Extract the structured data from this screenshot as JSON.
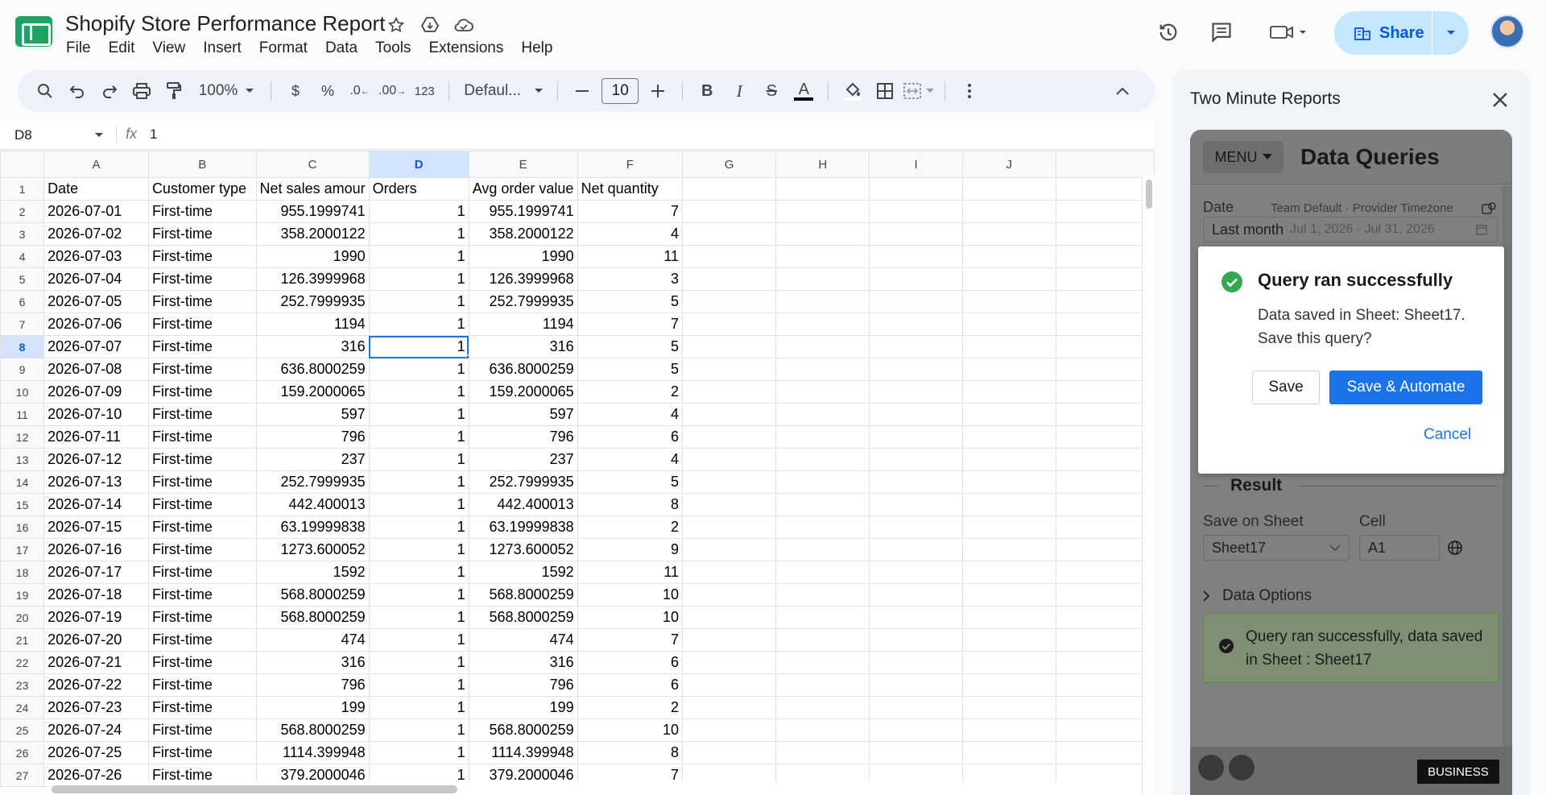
{
  "doc": {
    "title": "Shopify Store Performance Report"
  },
  "menu": [
    "File",
    "Edit",
    "View",
    "Insert",
    "Format",
    "Data",
    "Tools",
    "Extensions",
    "Help"
  ],
  "share": {
    "label": "Share"
  },
  "toolbar": {
    "zoom": "100%",
    "currency": "$",
    "percent": "%",
    "dec_less": ".0",
    "dec_more": ".00",
    "more_formats": "123",
    "font": "Defaul...",
    "font_size": "10",
    "bold": "B",
    "italic": "I",
    "strike": "S",
    "text_color": "A"
  },
  "formula_bar": {
    "cell_ref": "D8",
    "fx": "fx",
    "value": "1"
  },
  "grid": {
    "columns": [
      "A",
      "B",
      "C",
      "D",
      "E",
      "F",
      "G",
      "H",
      "I",
      "J"
    ],
    "selected_col": "D",
    "selected_row": 8,
    "headers": [
      "Date",
      "Customer type",
      "Net sales amour",
      "Orders",
      "Avg order value",
      "Net quantity"
    ],
    "rows": [
      [
        "2026-07-01",
        "First-time",
        "955.1999741",
        "1",
        "955.1999741",
        "7"
      ],
      [
        "2026-07-02",
        "First-time",
        "358.2000122",
        "1",
        "358.2000122",
        "4"
      ],
      [
        "2026-07-03",
        "First-time",
        "1990",
        "1",
        "1990",
        "11"
      ],
      [
        "2026-07-04",
        "First-time",
        "126.3999968",
        "1",
        "126.3999968",
        "3"
      ],
      [
        "2026-07-05",
        "First-time",
        "252.7999935",
        "1",
        "252.7999935",
        "5"
      ],
      [
        "2026-07-06",
        "First-time",
        "1194",
        "1",
        "1194",
        "7"
      ],
      [
        "2026-07-07",
        "First-time",
        "316",
        "1",
        "316",
        "5"
      ],
      [
        "2026-07-08",
        "First-time",
        "636.8000259",
        "1",
        "636.8000259",
        "5"
      ],
      [
        "2026-07-09",
        "First-time",
        "159.2000065",
        "1",
        "159.2000065",
        "2"
      ],
      [
        "2026-07-10",
        "First-time",
        "597",
        "1",
        "597",
        "4"
      ],
      [
        "2026-07-11",
        "First-time",
        "796",
        "1",
        "796",
        "6"
      ],
      [
        "2026-07-12",
        "First-time",
        "237",
        "1",
        "237",
        "4"
      ],
      [
        "2026-07-13",
        "First-time",
        "252.7999935",
        "1",
        "252.7999935",
        "5"
      ],
      [
        "2026-07-14",
        "First-time",
        "442.400013",
        "1",
        "442.400013",
        "8"
      ],
      [
        "2026-07-15",
        "First-time",
        "63.19999838",
        "1",
        "63.19999838",
        "2"
      ],
      [
        "2026-07-16",
        "First-time",
        "1273.600052",
        "1",
        "1273.600052",
        "9"
      ],
      [
        "2026-07-17",
        "First-time",
        "1592",
        "1",
        "1592",
        "11"
      ],
      [
        "2026-07-18",
        "First-time",
        "568.8000259",
        "1",
        "568.8000259",
        "10"
      ],
      [
        "2026-07-19",
        "First-time",
        "568.8000259",
        "1",
        "568.8000259",
        "10"
      ],
      [
        "2026-07-20",
        "First-time",
        "474",
        "1",
        "474",
        "7"
      ],
      [
        "2026-07-21",
        "First-time",
        "316",
        "1",
        "316",
        "6"
      ],
      [
        "2026-07-22",
        "First-time",
        "796",
        "1",
        "796",
        "6"
      ],
      [
        "2026-07-23",
        "First-time",
        "199",
        "1",
        "199",
        "2"
      ],
      [
        "2026-07-24",
        "First-time",
        "568.8000259",
        "1",
        "568.8000259",
        "10"
      ],
      [
        "2026-07-25",
        "First-time",
        "1114.399948",
        "1",
        "1114.399948",
        "8"
      ],
      [
        "2026-07-26",
        "First-time",
        "379.2000046",
        "1",
        "379.2000046",
        "7"
      ]
    ]
  },
  "sidepanel": {
    "title": "Two Minute Reports",
    "menu_label": "MENU",
    "heading": "Data Queries",
    "date_label": "Date",
    "date_meta": "Team Default · Provider Timezone",
    "date_value": "Last month",
    "date_range": "Jul 1, 2026 - Jul 31, 2026",
    "result_label": "Result",
    "save_on_sheet_label": "Save on Sheet",
    "cell_label": "Cell",
    "sheet_value": "Sheet17",
    "cell_value": "A1",
    "data_options": "Data Options",
    "status_msg": "Query ran successfully, data saved in Sheet : Sheet17",
    "badge": "BUSINESS"
  },
  "modal": {
    "title": "Query ran successfully",
    "body": "Data saved in Sheet: Sheet17. Save this query?",
    "save": "Save",
    "save_automate": "Save & Automate",
    "cancel": "Cancel"
  },
  "colors": {
    "accent": "#1a73e8",
    "success": "#34a853",
    "share_bg": "#c2e7ff",
    "sheets_green": "#1ea362"
  }
}
